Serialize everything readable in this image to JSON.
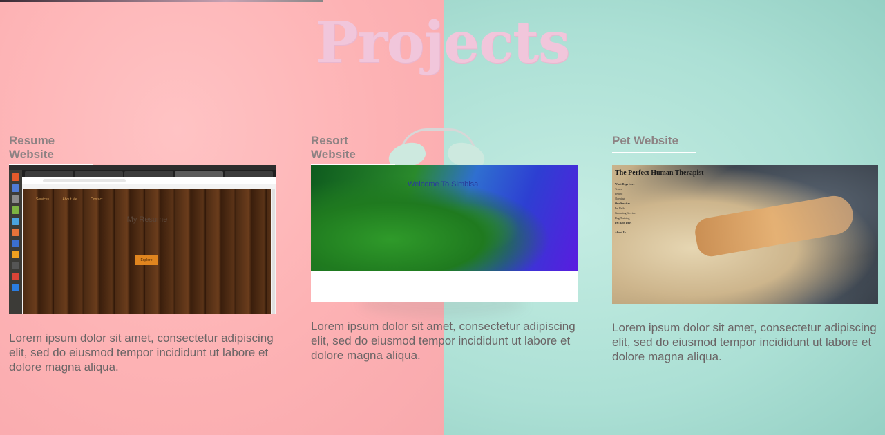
{
  "page": {
    "title": "Projects"
  },
  "projects": [
    {
      "title": "Resume Website",
      "description": "Lorem ipsum dolor sit amet, consectetur adipiscing elit, sed do eiusmod tempor incididunt ut labore et dolore magna aliqua.",
      "screenshot": {
        "nav": [
          "Services",
          "About Me",
          "Contact"
        ],
        "heading": "My Resume",
        "button": "Explore"
      }
    },
    {
      "title": "Resort Website",
      "description": "Lorem ipsum dolor sit amet, consectetur adipiscing elit, sed do eiusmod tempor incididunt ut labore et dolore magna aliqua.",
      "screenshot": {
        "heading": "Welcome To Simbisa"
      }
    },
    {
      "title": "Pet Website",
      "description": "Lorem ipsum dolor sit amet, consectetur adipiscing elit, sed do eiusmod tempor incididunt ut labore et dolore magna aliqua.",
      "screenshot": {
        "heading": "The Perfect Human Therapist",
        "sections": [
          "What Dogs Love",
          "Our Services",
          "Pet Bath Days",
          "About Us"
        ],
        "list_items": [
          "Treats",
          "Petting",
          "Sleeping",
          "Pet Bath",
          "Grooming Services",
          "Dog Training"
        ]
      }
    }
  ],
  "colors": {
    "left_bg": "#fdb2b4",
    "right_bg": "#ace0d5",
    "title": "#f1c6db",
    "card_title": "#8d8283",
    "body_text": "#6b6566"
  }
}
